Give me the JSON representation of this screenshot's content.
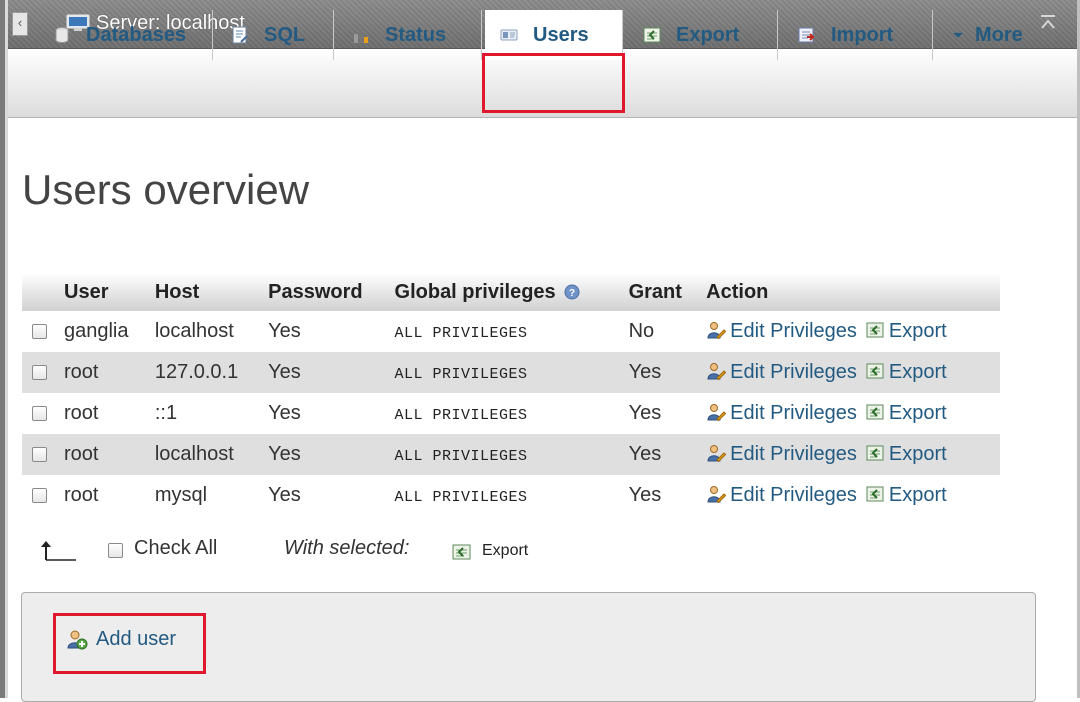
{
  "window": {
    "server_label": "Server: localhost",
    "collapse_glyph": "‹"
  },
  "tabs": [
    {
      "label": "Databases",
      "icon": "database-icon"
    },
    {
      "label": "SQL",
      "icon": "sql-icon"
    },
    {
      "label": "Status",
      "icon": "status-chart-icon"
    },
    {
      "label": "Users",
      "icon": "users-icon",
      "active": true
    },
    {
      "label": "Export",
      "icon": "export-icon"
    },
    {
      "label": "Import",
      "icon": "import-icon"
    },
    {
      "label": "More",
      "icon": "dropdown-triangle-icon"
    }
  ],
  "page": {
    "title": "Users overview"
  },
  "table": {
    "headers": {
      "user": "User",
      "host": "Host",
      "password": "Password",
      "global_privileges": "Global privileges",
      "grant": "Grant",
      "action": "Action"
    },
    "rows": [
      {
        "user": "ganglia",
        "host": "localhost",
        "password": "Yes",
        "privileges": "ALL PRIVILEGES",
        "grant": "No",
        "edit": "Edit Privileges",
        "export": "Export"
      },
      {
        "user": "root",
        "host": "127.0.0.1",
        "password": "Yes",
        "privileges": "ALL PRIVILEGES",
        "grant": "Yes",
        "edit": "Edit Privileges",
        "export": "Export"
      },
      {
        "user": "root",
        "host": "::1",
        "password": "Yes",
        "privileges": "ALL PRIVILEGES",
        "grant": "Yes",
        "edit": "Edit Privileges",
        "export": "Export"
      },
      {
        "user": "root",
        "host": "localhost",
        "password": "Yes",
        "privileges": "ALL PRIVILEGES",
        "grant": "Yes",
        "edit": "Edit Privileges",
        "export": "Export"
      },
      {
        "user": "root",
        "host": "mysql",
        "password": "Yes",
        "privileges": "ALL PRIVILEGES",
        "grant": "Yes",
        "edit": "Edit Privileges",
        "export": "Export"
      }
    ]
  },
  "footer": {
    "check_all": "Check All",
    "with_selected": "With selected:",
    "export": "Export"
  },
  "add_user": {
    "label": "Add user"
  },
  "colors": {
    "link": "#235a81",
    "highlight": "#e0182d",
    "row_alt": "#dfdfdf"
  }
}
